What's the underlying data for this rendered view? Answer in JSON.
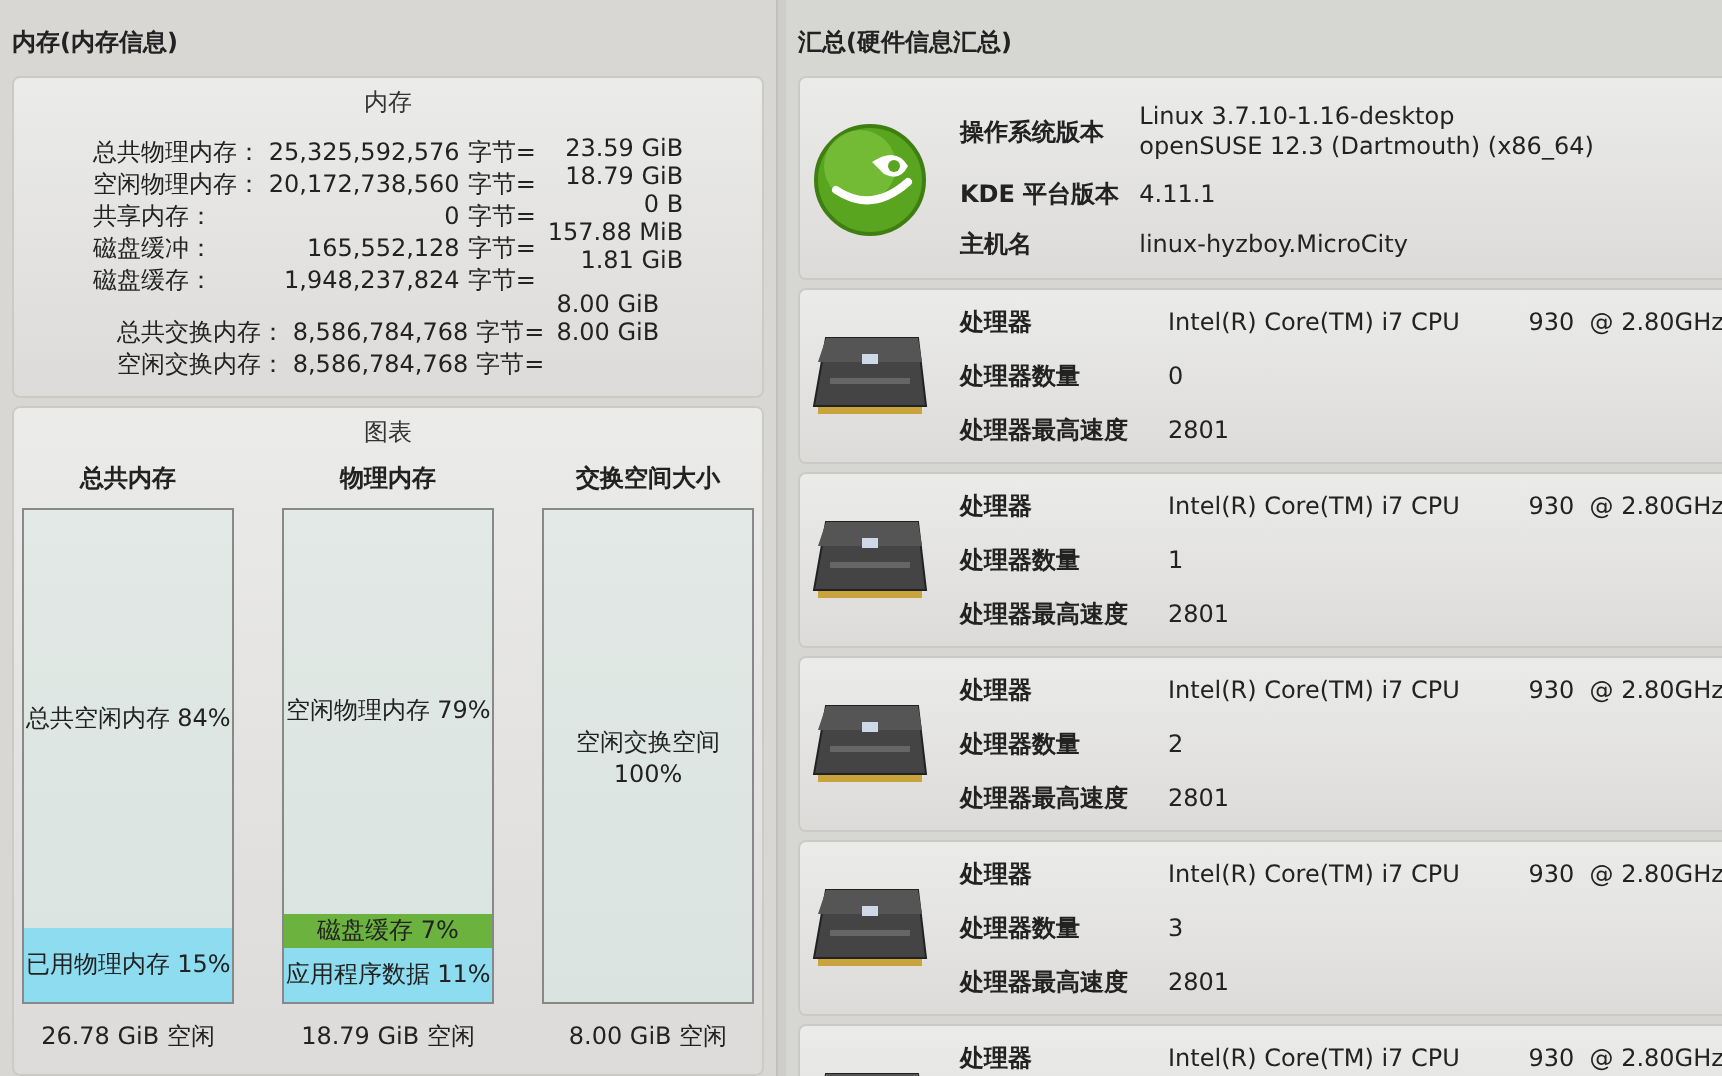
{
  "memory_panel": {
    "title": "内存(内存信息)",
    "info_card": {
      "title": "内存",
      "rows": [
        {
          "label": "总共物理内存：",
          "bytes": "25,325,592,576",
          "unit": "字节="
        },
        {
          "label": "空闲物理内存：",
          "bytes": "20,172,738,560",
          "unit": "字节="
        },
        {
          "label": "共享内存：",
          "bytes": "0",
          "unit": "字节="
        },
        {
          "label": "磁盘缓冲：",
          "bytes": "165,552,128",
          "unit": "字节="
        },
        {
          "label": "磁盘缓存：",
          "bytes": "1,948,237,824",
          "unit": "字节="
        }
      ],
      "values": [
        "23.59 GiB",
        "18.79 GiB",
        "0 B",
        "157.88 MiB",
        "1.81 GiB"
      ],
      "swap_rows": [
        {
          "label": "总共交换内存：",
          "bytes": "8,586,784,768",
          "unit": "字节="
        },
        {
          "label": "空闲交换内存：",
          "bytes": "8,586,784,768",
          "unit": "字节="
        }
      ],
      "swap_values": [
        "8.00 GiB",
        "8.00 GiB"
      ]
    },
    "chart_card": {
      "title": "图表",
      "bars": [
        {
          "title": "总共内存",
          "segments": [
            {
              "kind": "free",
              "label": "总共空闲内存 84%"
            },
            {
              "kind": "used",
              "label": "已用物理内存 15%",
              "level": 0.15,
              "color": "#8ddcef"
            }
          ],
          "footer": "26.78 GiB 空闲"
        },
        {
          "title": "物理内存",
          "segments": [
            {
              "kind": "free",
              "label": "空闲物理内存 79%"
            },
            {
              "kind": "used",
              "label": "磁盘缓存 7%",
              "level": 0.07,
              "color": "#6cb23e"
            },
            {
              "kind": "used",
              "label": "应用程序数据 11%",
              "level": 0.11,
              "color": "#8ddcef"
            }
          ],
          "footer": "18.79 GiB 空闲"
        },
        {
          "title": "交换空间大小",
          "segments": [
            {
              "kind": "free",
              "label": "空闲交换空间\n100%"
            }
          ],
          "footer": "8.00 GiB 空闲"
        }
      ]
    }
  },
  "summary_panel": {
    "title": "汇总(硬件信息汇总)",
    "cards": [
      {
        "kind": "os",
        "rows": [
          {
            "label": "操作系统版本",
            "value": "Linux 3.7.10-1.16-desktop\nopenSUSE 12.3 (Dartmouth) (x86_64)"
          },
          {
            "label": "KDE 平台版本",
            "value": "4.11.1"
          },
          {
            "label": "主机名",
            "value": "linux-hyzboy.MicroCity"
          }
        ]
      },
      {
        "kind": "cpu",
        "rows": [
          {
            "label": "处理器",
            "value": "Intel(R) Core(TM) i7 CPU         930  @ 2.80GHz"
          },
          {
            "label": "处理器数量",
            "value": "0"
          },
          {
            "label": "处理器最高速度",
            "value": "2801"
          }
        ]
      },
      {
        "kind": "cpu",
        "rows": [
          {
            "label": "处理器",
            "value": "Intel(R) Core(TM) i7 CPU         930  @ 2.80GHz"
          },
          {
            "label": "处理器数量",
            "value": "1"
          },
          {
            "label": "处理器最高速度",
            "value": "2801"
          }
        ]
      },
      {
        "kind": "cpu",
        "rows": [
          {
            "label": "处理器",
            "value": "Intel(R) Core(TM) i7 CPU         930  @ 2.80GHz"
          },
          {
            "label": "处理器数量",
            "value": "2"
          },
          {
            "label": "处理器最高速度",
            "value": "2801"
          }
        ]
      },
      {
        "kind": "cpu",
        "rows": [
          {
            "label": "处理器",
            "value": "Intel(R) Core(TM) i7 CPU         930  @ 2.80GHz"
          },
          {
            "label": "处理器数量",
            "value": "3"
          },
          {
            "label": "处理器最高速度",
            "value": "2801"
          }
        ]
      },
      {
        "kind": "cpu",
        "rows": [
          {
            "label": "处理器",
            "value": "Intel(R) Core(TM) i7 CPU         930  @ 2.80GHz"
          }
        ]
      }
    ]
  }
}
